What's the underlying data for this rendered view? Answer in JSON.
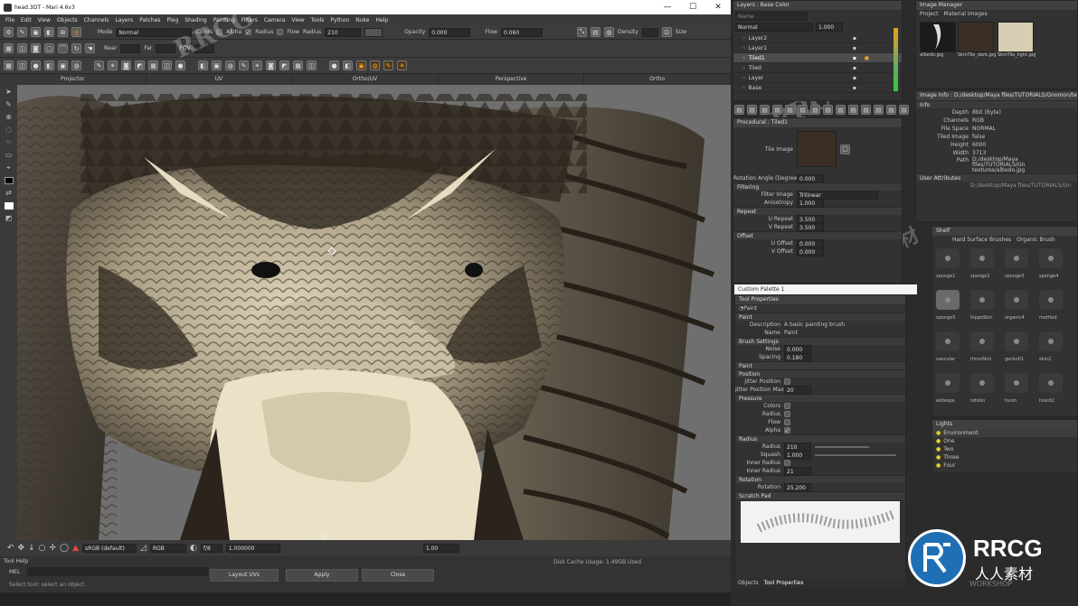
{
  "window": {
    "title": "head.3DT - Mari 4.6v3",
    "controls": [
      "—",
      "☐",
      "✕"
    ]
  },
  "menu": [
    "File",
    "Edit",
    "View",
    "Objects",
    "Channels",
    "Layers",
    "Patches",
    "Pleg",
    "Shading",
    "Painting",
    "Filters",
    "Camera",
    "View",
    "Tools",
    "Python",
    "Nuke",
    "Help"
  ],
  "toolbar1": {
    "mode_label": "Mode",
    "mode_value": "Normal",
    "colors_label": "Colors",
    "alpha_label": "Alpha",
    "radius_check_label": "Radius",
    "flow_check_label": "Flow",
    "radius_label": "Radius",
    "radius_value": "210",
    "opacity_label": "Opacity",
    "opacity_value": "0.000",
    "flow_label": "Flow",
    "flow_value": "0.060",
    "density_label": "Density",
    "size_label": "Size"
  },
  "toolbar2": {
    "near_label": "Near",
    "far_label": "Far",
    "fov_label": "FOV"
  },
  "view_tabs": [
    "Projector",
    "UV",
    "Ortho/UV",
    "Perspective",
    "Ortho"
  ],
  "statusbar": {
    "colorspace": "sRGB (default)",
    "channel": "RGB",
    "fstop": "f/8",
    "gain": "1.000000",
    "gamma": "1.00"
  },
  "bottom": {
    "tool_help": "Tool Help",
    "mel": "MEL",
    "hint": "Select tool: select an object",
    "cache": "Disk Cache Usage: 1.49GB Used",
    "buttons": [
      "Layout UVs",
      "Apply",
      "Close"
    ]
  },
  "layers": {
    "title": "Layers : Base Color",
    "search_placeholder": "Name",
    "blend": "Normal",
    "opacity": "1.000",
    "items": [
      "Layer2",
      "Layer1",
      "Tiled1",
      "Tiled",
      "Layer",
      "Base"
    ],
    "selected_index": 2
  },
  "procedural": {
    "title": "Procedural : Tiled1",
    "tile_image_label": "Tile Image",
    "rotation_label": "Rotation Angle (Degrees)",
    "rotation_value": "0.000",
    "filtering_label": "Filtering",
    "filter_image_label": "Filter Image",
    "filter_image_value": "Trilinear",
    "anisotropy_label": "Anisotropy",
    "anisotropy_value": "1.000",
    "repeat_label": "Repeat",
    "u_repeat_label": "U Repeat",
    "u_repeat_value": "3.500",
    "v_repeat_label": "V Repeat",
    "v_repeat_value": "3.500",
    "offset_label": "Offset",
    "u_offset_label": "U Offset",
    "u_offset_value": "0.000",
    "v_offset_label": "V Offset",
    "v_offset_value": "0.000"
  },
  "custom_palette": {
    "title": "Custom Palette 1"
  },
  "tool_props": {
    "title": "Tool Properties",
    "tool": "Paint",
    "paint_section": "Paint",
    "description_label": "Description",
    "description_value": "A basic painting brush",
    "name_label": "Name",
    "name_value": "Paint",
    "brush_settings": "Brush Settings",
    "noise_label": "Noise",
    "noise_value": "0.000",
    "spacing_label": "Spacing",
    "spacing_value": "0.180",
    "paint_subsection": "Paint",
    "position_section": "Position",
    "jitter_position_label": "Jitter Position",
    "jitter_position_max_label": "Jitter Position Max",
    "jitter_position_max_value": "20",
    "pressure_section": "Pressure",
    "pressure_items": [
      "Colors",
      "Radius",
      "Flow",
      "Alpha"
    ],
    "radius_section": "Radius",
    "radius_label": "Radius",
    "radius_value": "210",
    "squash_label": "Squash",
    "squash_value": "1.000",
    "inner_radius_label": "Inner Radius",
    "inner_radius_max_label": "Inner Radius",
    "inner_radius_max_value": "21",
    "rotation_section": "Rotation",
    "rotation_label": "Rotation",
    "rotation_value": "25.200",
    "scratch_pad": "Scratch Pad",
    "tabs": [
      "Objects",
      "Tool Properties"
    ]
  },
  "image_manager": {
    "title": "Image Manager",
    "tabs": [
      "Project",
      "Material Images"
    ],
    "thumbs": [
      "albedo.jpg",
      "SkinTile_dark.jpg",
      "SkinTile_light.jpg"
    ]
  },
  "image_info": {
    "title": "Image Info : D:/desktop/Maya files/TUTORIALS/Gnomon/text",
    "info_label": "Info",
    "rows": [
      {
        "k": "Depth",
        "v": "8bit (Byte)"
      },
      {
        "k": "Channels",
        "v": "RGB"
      },
      {
        "k": "File Space",
        "v": "NORMAL"
      },
      {
        "k": "Tiled Image",
        "v": "false"
      },
      {
        "k": "Height",
        "v": "6000"
      },
      {
        "k": "Width",
        "v": "3713"
      },
      {
        "k": "Path",
        "v": "D:/desktop/Maya files/TUTORIALS/Gn textures/albedo.jpg"
      }
    ],
    "user_attributes": "User Attributes",
    "user_path": "D:/desktop/Maya files/TUTORIALS/Gn"
  },
  "shelf": {
    "title": "Shelf",
    "tabs": [
      "Hard Surface Brushes",
      "Organic Brush"
    ],
    "brushes": [
      "sponge1",
      "sponge2",
      "sponge3",
      "sponge4",
      "sponge5",
      "hippoSkin",
      "organic4",
      "mottled",
      "vascular",
      "rhinoSkin",
      "gecko01",
      "skin2",
      "widespa",
      "ndskin",
      "hvsin",
      "lizard2"
    ]
  },
  "lights": {
    "title": "Lights",
    "items": [
      "Environment",
      "One",
      "Two",
      "Three",
      "Four"
    ]
  },
  "watermarks": [
    "RRCG",
    "人人素材",
    "RRCG",
    "RRCG",
    "人人素材",
    "RRCG"
  ],
  "logo": {
    "text": "RRCG",
    "subtitle": "人人素材",
    "sub2": "WORKSHOP"
  },
  "colors": {
    "accent": "#e8a020",
    "selected_layer": "#4d4d4d",
    "logo_blue": "#1f6fb5",
    "light_bulb": "#e6d020"
  }
}
